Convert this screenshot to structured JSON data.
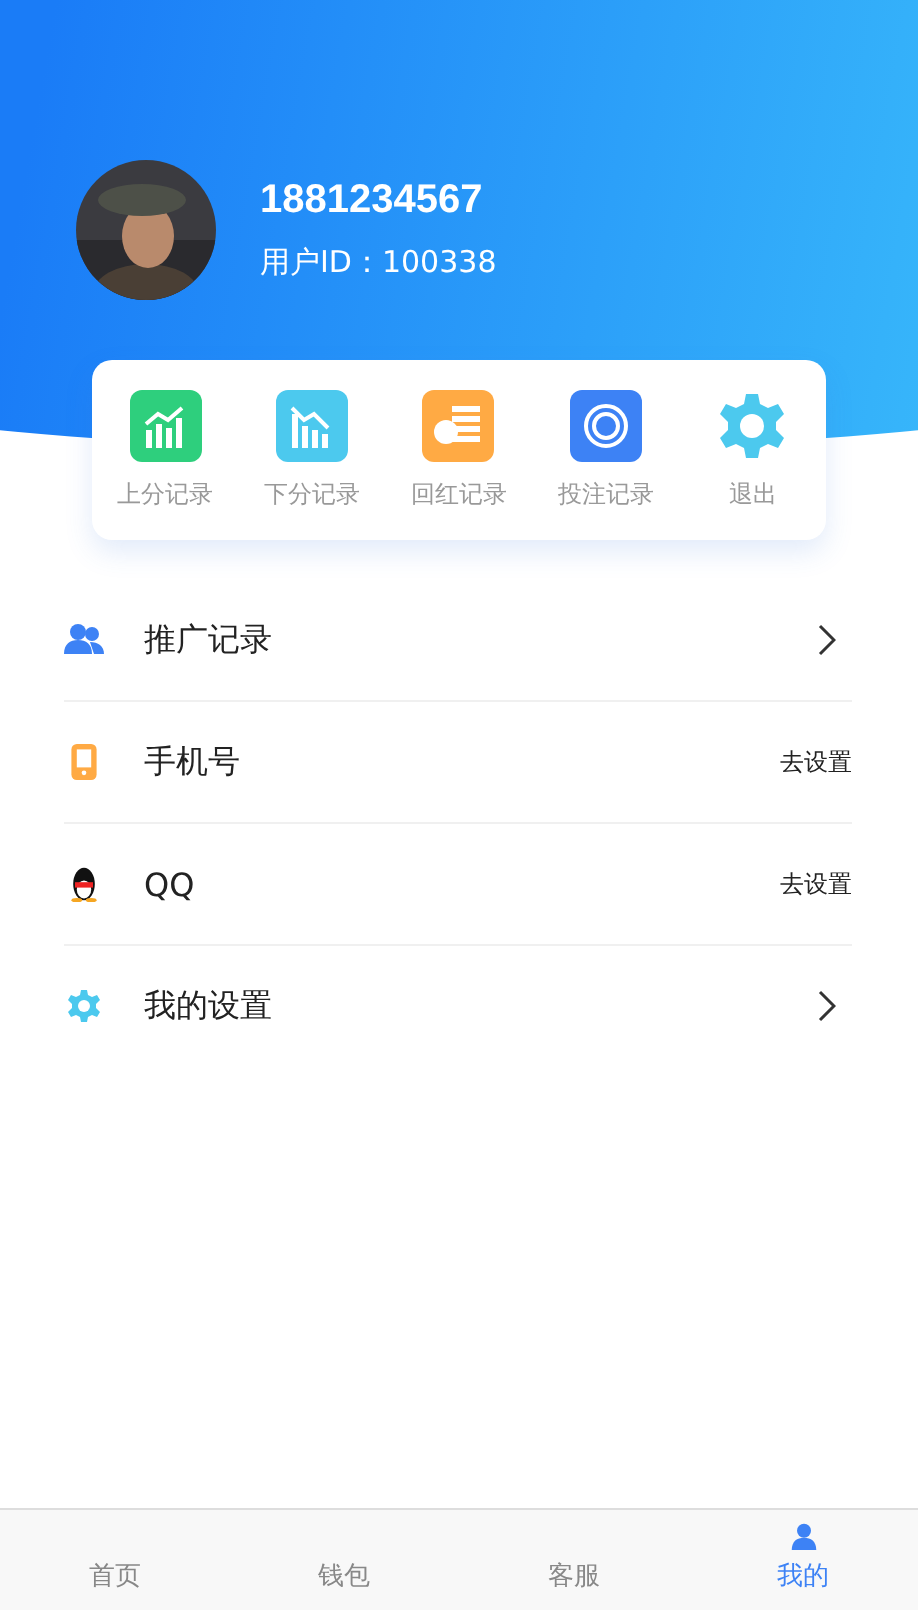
{
  "profile": {
    "phone": "1881234567",
    "user_id": "用户ID：100338"
  },
  "shortcuts": [
    {
      "label": "上分记录",
      "kind": "up",
      "color": "#2ecf7d"
    },
    {
      "label": "下分记录",
      "kind": "down",
      "color": "#4cc9ee"
    },
    {
      "label": "回红记录",
      "kind": "coins",
      "color": "#ffaa44"
    },
    {
      "label": "投注记录",
      "kind": "chip",
      "color": "#3d82f5"
    },
    {
      "label": "退出",
      "kind": "gear",
      "color": "#4cc9ee"
    }
  ],
  "menu": [
    {
      "label": "推广记录",
      "kind": "arrow"
    },
    {
      "label": "手机号",
      "kind": "text",
      "action": "去设置"
    },
    {
      "label": "QQ",
      "kind": "text",
      "action": "去设置"
    },
    {
      "label": "我的设置",
      "kind": "arrow"
    }
  ],
  "tabbar": [
    {
      "label": "首页",
      "selected": false
    },
    {
      "label": "钱包",
      "selected": false
    },
    {
      "label": "客服",
      "selected": false
    },
    {
      "label": "我的",
      "selected": true
    }
  ]
}
